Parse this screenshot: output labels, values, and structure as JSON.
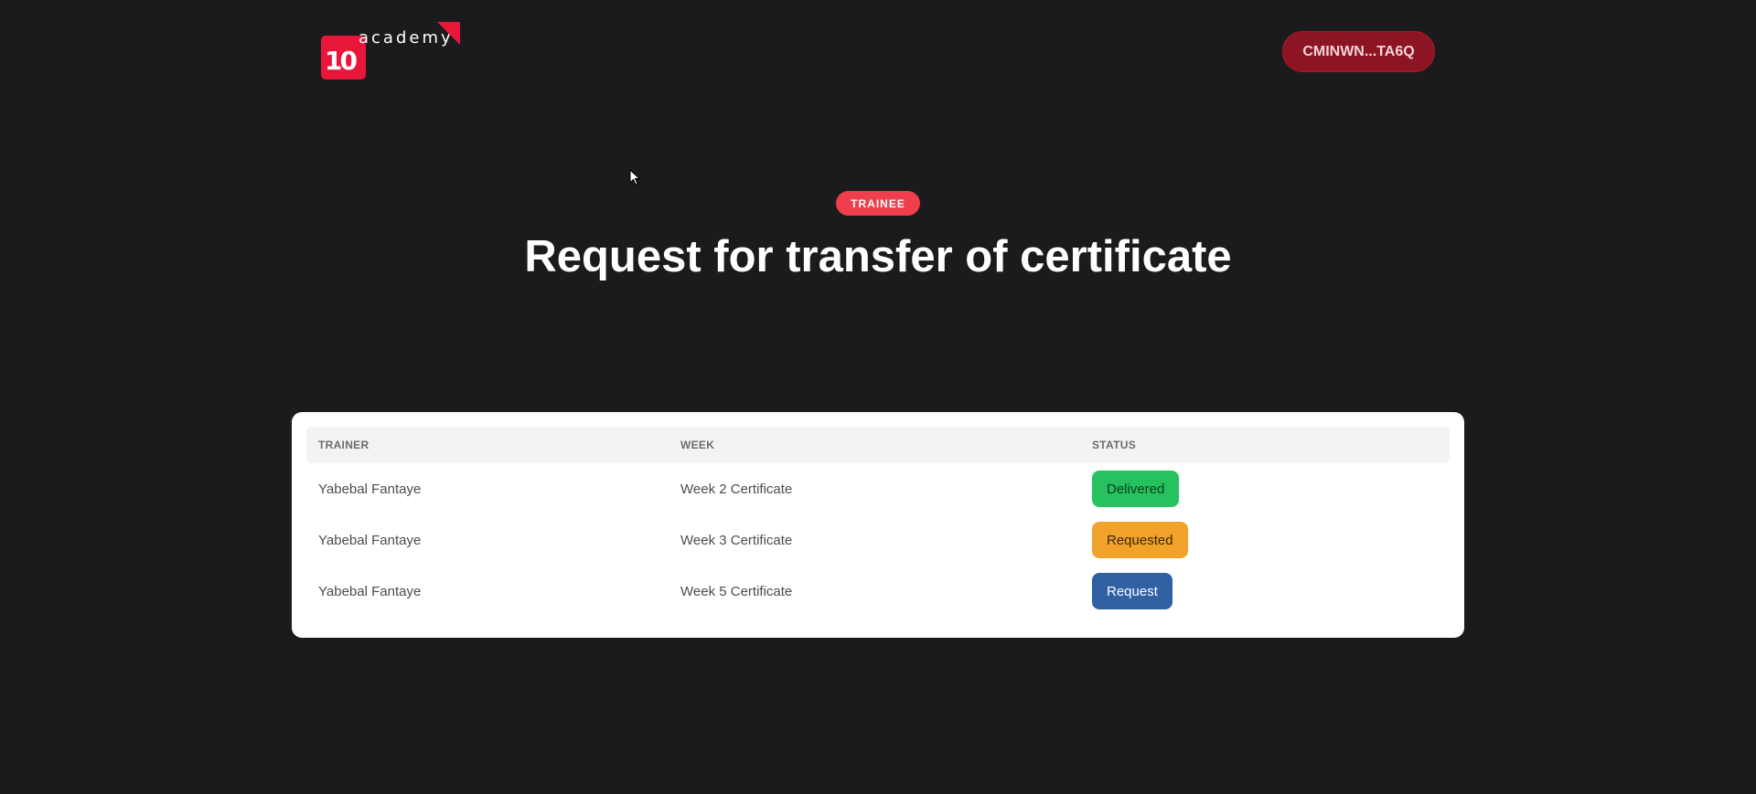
{
  "header": {
    "logo": {
      "mark": "10",
      "text": "academy"
    },
    "wallet_label": "CMINWN...TA6Q"
  },
  "hero": {
    "badge": "TRAINEE",
    "title": "Request for transfer of certificate"
  },
  "table": {
    "columns": [
      "TRAINER",
      "WEEK",
      "STATUS"
    ],
    "rows": [
      {
        "trainer": "Yabebal Fantaye",
        "week": "Week 2 Certificate",
        "status": "Delivered",
        "status_color": "#25c25f"
      },
      {
        "trainer": "Yabebal Fantaye",
        "week": "Week 3 Certificate",
        "status": "Requested",
        "status_color": "#f0a22b"
      },
      {
        "trainer": "Yabebal Fantaye",
        "week": "Week 5 Certificate",
        "status": "Request",
        "status_color": "#2f61a3"
      }
    ]
  },
  "colors": {
    "background": "#1b1b1d",
    "brand_red": "#e8173a",
    "badge_red": "#ef3f4d",
    "wallet_button": "#8d1423"
  },
  "icons": {
    "cursor": "mouse-pointer-icon"
  }
}
